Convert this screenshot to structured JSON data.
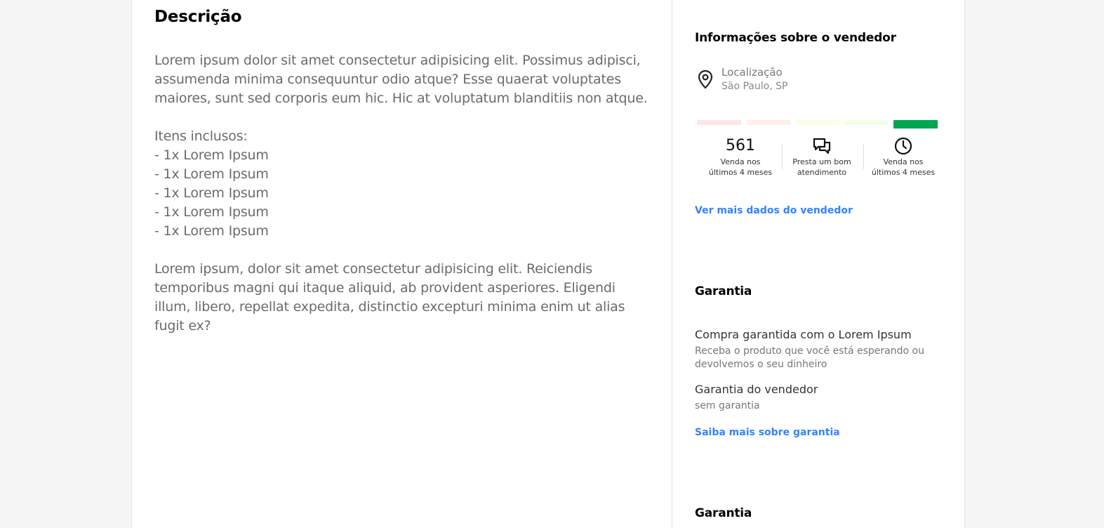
{
  "description": {
    "title": "Descrição",
    "paragraph1": "Lorem ipsum dolor sit amet consectetur adipisicing elit. Possimus adipisci, assumenda minima consequuntur odio atque? Esse quaerat voluptates maiores, sunt sed corporis eum hic. Hic at voluptatum blanditiis non atque.",
    "items_label": "Itens inclusos:",
    "items": [
      "- 1x Lorem Ipsum",
      "- 1x Lorem Ipsum",
      "- 1x Lorem Ipsum",
      "- 1x Lorem Ipsum",
      "- 1x Lorem Ipsum"
    ],
    "paragraph2": "Lorem ipsum, dolor sit amet consectetur adipisicing elit. Reiciendis temporibus magni qui itaque aliquid, ab provident asperiores. Eligendi illum, libero, repellat expedita, distinctio excepturi minima enim ut alias fugit ex?"
  },
  "seller": {
    "title": "Informações sobre o vendedor",
    "location_label": "Localização",
    "location_value": "São Paulo, SP",
    "reputation_level": 5,
    "reputation_colors": [
      "#fee6e6",
      "#fff0e8",
      "#fefde6",
      "#f0fee6",
      "#00a650"
    ],
    "metrics": [
      {
        "value": "561",
        "caption": "Venda nos últimos 4 meses"
      },
      {
        "icon": "chat-bubbles-icon",
        "caption": "Presta um bom atendimento"
      },
      {
        "icon": "clock-icon",
        "caption": "Venda nos últimos 4 meses"
      }
    ],
    "more_link": "Ver mais dados do vendedor"
  },
  "warranty": {
    "title": "Garantia",
    "items": [
      {
        "title": "Compra garantida com o Lorem Ipsum",
        "subtitle": "Receba o produto que você está esperando ou devolvemos o seu dinheiro"
      },
      {
        "title": "Garantia do vendedor",
        "subtitle": "sem garantia"
      }
    ],
    "more_link": "Saiba mais sobre garantia"
  },
  "warranty2": {
    "title": "Garantia"
  },
  "colors": {
    "link": "#3483fa",
    "reputation_active": "#00a650"
  }
}
